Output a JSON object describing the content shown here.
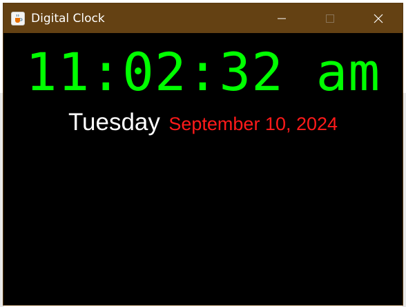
{
  "window": {
    "title": "Digital Clock",
    "icon": "java-coffee-cup-icon"
  },
  "titlebar_buttons": {
    "minimize_icon": "minimize-icon",
    "maximize_icon": "maximize-icon",
    "close_icon": "close-icon"
  },
  "clock": {
    "time": "11:02:32 am",
    "day": "Tuesday",
    "date": "September 10, 2024"
  },
  "colors": {
    "titlebar": "#644113",
    "background": "#000000",
    "time": "#00ff00",
    "day": "#ffffff",
    "date": "#ff1a1a"
  }
}
